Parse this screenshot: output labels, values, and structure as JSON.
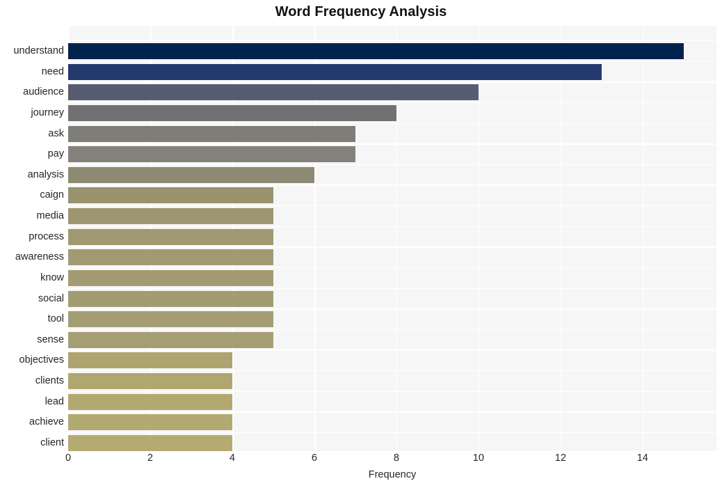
{
  "chart_data": {
    "type": "bar",
    "orientation": "horizontal",
    "title": "Word Frequency Analysis",
    "xlabel": "Frequency",
    "ylabel": "",
    "xlim": [
      0,
      15.8
    ],
    "ylim": null,
    "grid": true,
    "legend": null,
    "xticks": [
      0,
      2,
      4,
      6,
      8,
      10,
      12,
      14
    ],
    "xticklabels": [
      "0",
      "2",
      "4",
      "6",
      "8",
      "10",
      "12",
      "14"
    ],
    "categories": [
      "understand",
      "need",
      "audience",
      "journey",
      "ask",
      "pay",
      "analysis",
      "caign",
      "media",
      "process",
      "awareness",
      "know",
      "social",
      "tool",
      "sense",
      "objectives",
      "clients",
      "lead",
      "achieve",
      "client"
    ],
    "values": [
      15,
      13,
      10,
      8,
      7,
      7,
      6,
      5,
      5,
      5,
      5,
      5,
      5,
      5,
      5,
      4,
      4,
      4,
      4,
      4
    ],
    "bar_colors": [
      "#00234d",
      "#23396e",
      "#585c70",
      "#717174",
      "#7f7d77",
      "#838179",
      "#8d8a74",
      "#98926d",
      "#9d9670",
      "#a09972",
      "#a19a72",
      "#a29b73",
      "#a39c73",
      "#a49d74",
      "#a59e74",
      "#ada46f",
      "#b0a770",
      "#b2a971",
      "#b3aa71",
      "#b4ab72"
    ],
    "plot_background": "#f6f6f7",
    "gridline_color": "#ffffff",
    "figure_background": "#ffffff",
    "text_color": "#262626"
  }
}
